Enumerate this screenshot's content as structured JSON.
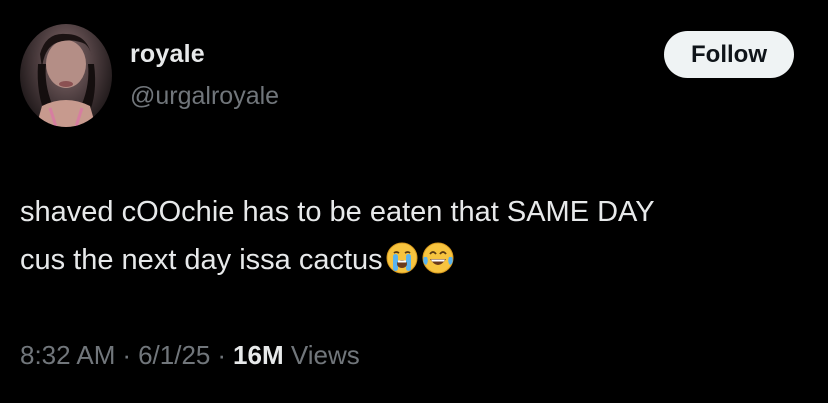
{
  "author": {
    "display_name": "royale",
    "handle": "@urgalroyale"
  },
  "follow_label": "Follow",
  "tweet": {
    "line1": "shaved cOOchie has to be eaten that SAME DAY",
    "line2": "cus the next day issa cactus",
    "emojis": [
      "loudly-crying-face-icon",
      "face-with-tears-of-joy-icon"
    ]
  },
  "meta": {
    "time": "8:32 AM",
    "separator": "·",
    "date": "6/1/25",
    "views_count": "16M",
    "views_label": "Views"
  },
  "colors": {
    "background": "#000000",
    "primary_text": "#e7e9ea",
    "secondary_text": "#71767b",
    "follow_bg": "#eff3f4"
  }
}
